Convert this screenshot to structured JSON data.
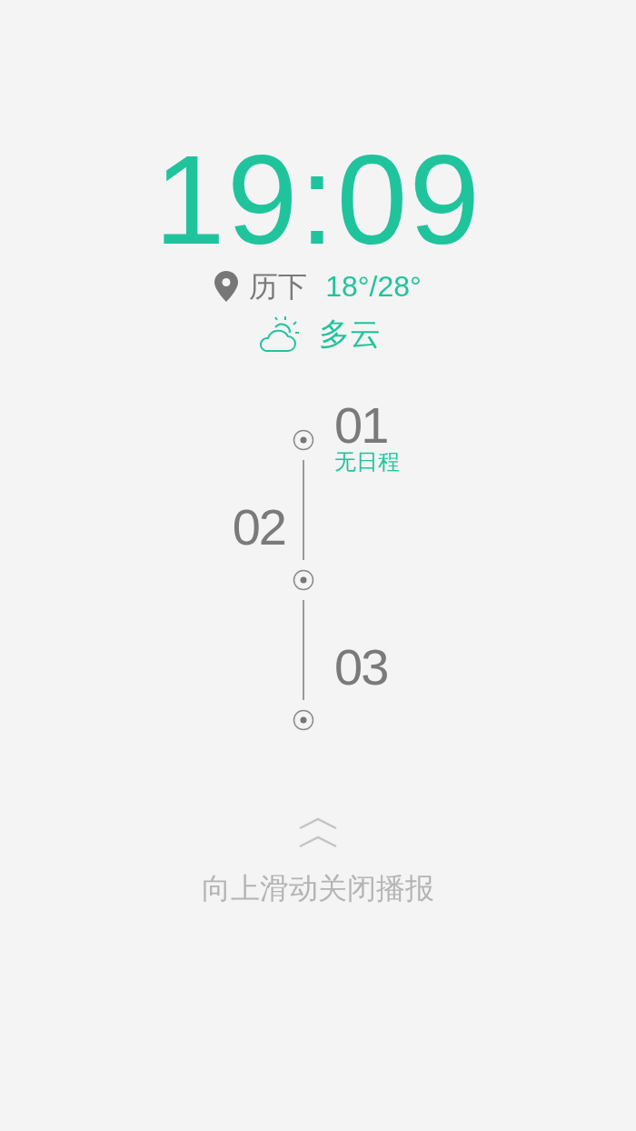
{
  "clock": {
    "time": "19:09"
  },
  "weather": {
    "location": "历下",
    "temperature": "18°/28°",
    "condition": "多云"
  },
  "timeline": [
    {
      "label": "01",
      "kind": "right",
      "note": "无日程"
    },
    {
      "label": "02",
      "kind": "left"
    },
    {
      "label": "03",
      "kind": "right"
    }
  ],
  "hint": {
    "text": "向上滑动关闭播报"
  }
}
